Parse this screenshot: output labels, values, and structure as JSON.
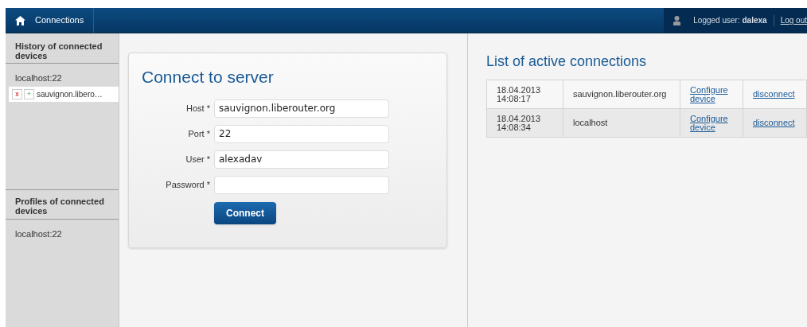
{
  "nav": {
    "home": "Connections",
    "user_label": "Logged user:",
    "user": "dalexa",
    "logout": "Log out"
  },
  "history": {
    "title": "History of connected devices",
    "items": [
      {
        "text": "localhost:22",
        "kind": "plain"
      },
      {
        "text": "sauvignon.libero…",
        "kind": "actions",
        "remove": "x",
        "add": "+"
      }
    ]
  },
  "profiles": {
    "title": "Profiles of connected devices",
    "items": [
      "localhost:22"
    ]
  },
  "form": {
    "title": "Connect to server",
    "fields": [
      {
        "label": "Host *",
        "value": "sauvignon.liberouter.org"
      },
      {
        "label": "Port *",
        "value": "22"
      },
      {
        "label": "User *",
        "value": "alexadav"
      },
      {
        "label": "Password *"
      }
    ],
    "button": "Connect"
  },
  "connections": {
    "title": "List of active connections",
    "rows": [
      {
        "time": "18.04.2013 14:08:17",
        "host": "sauvignon.liberouter.org",
        "configure": "Configure device",
        "disconnect": "disconnect"
      },
      {
        "time": "18.04.2013 14:08:34",
        "host": "localhost",
        "configure": "Configure device",
        "disconnect": "disconnect"
      }
    ]
  }
}
